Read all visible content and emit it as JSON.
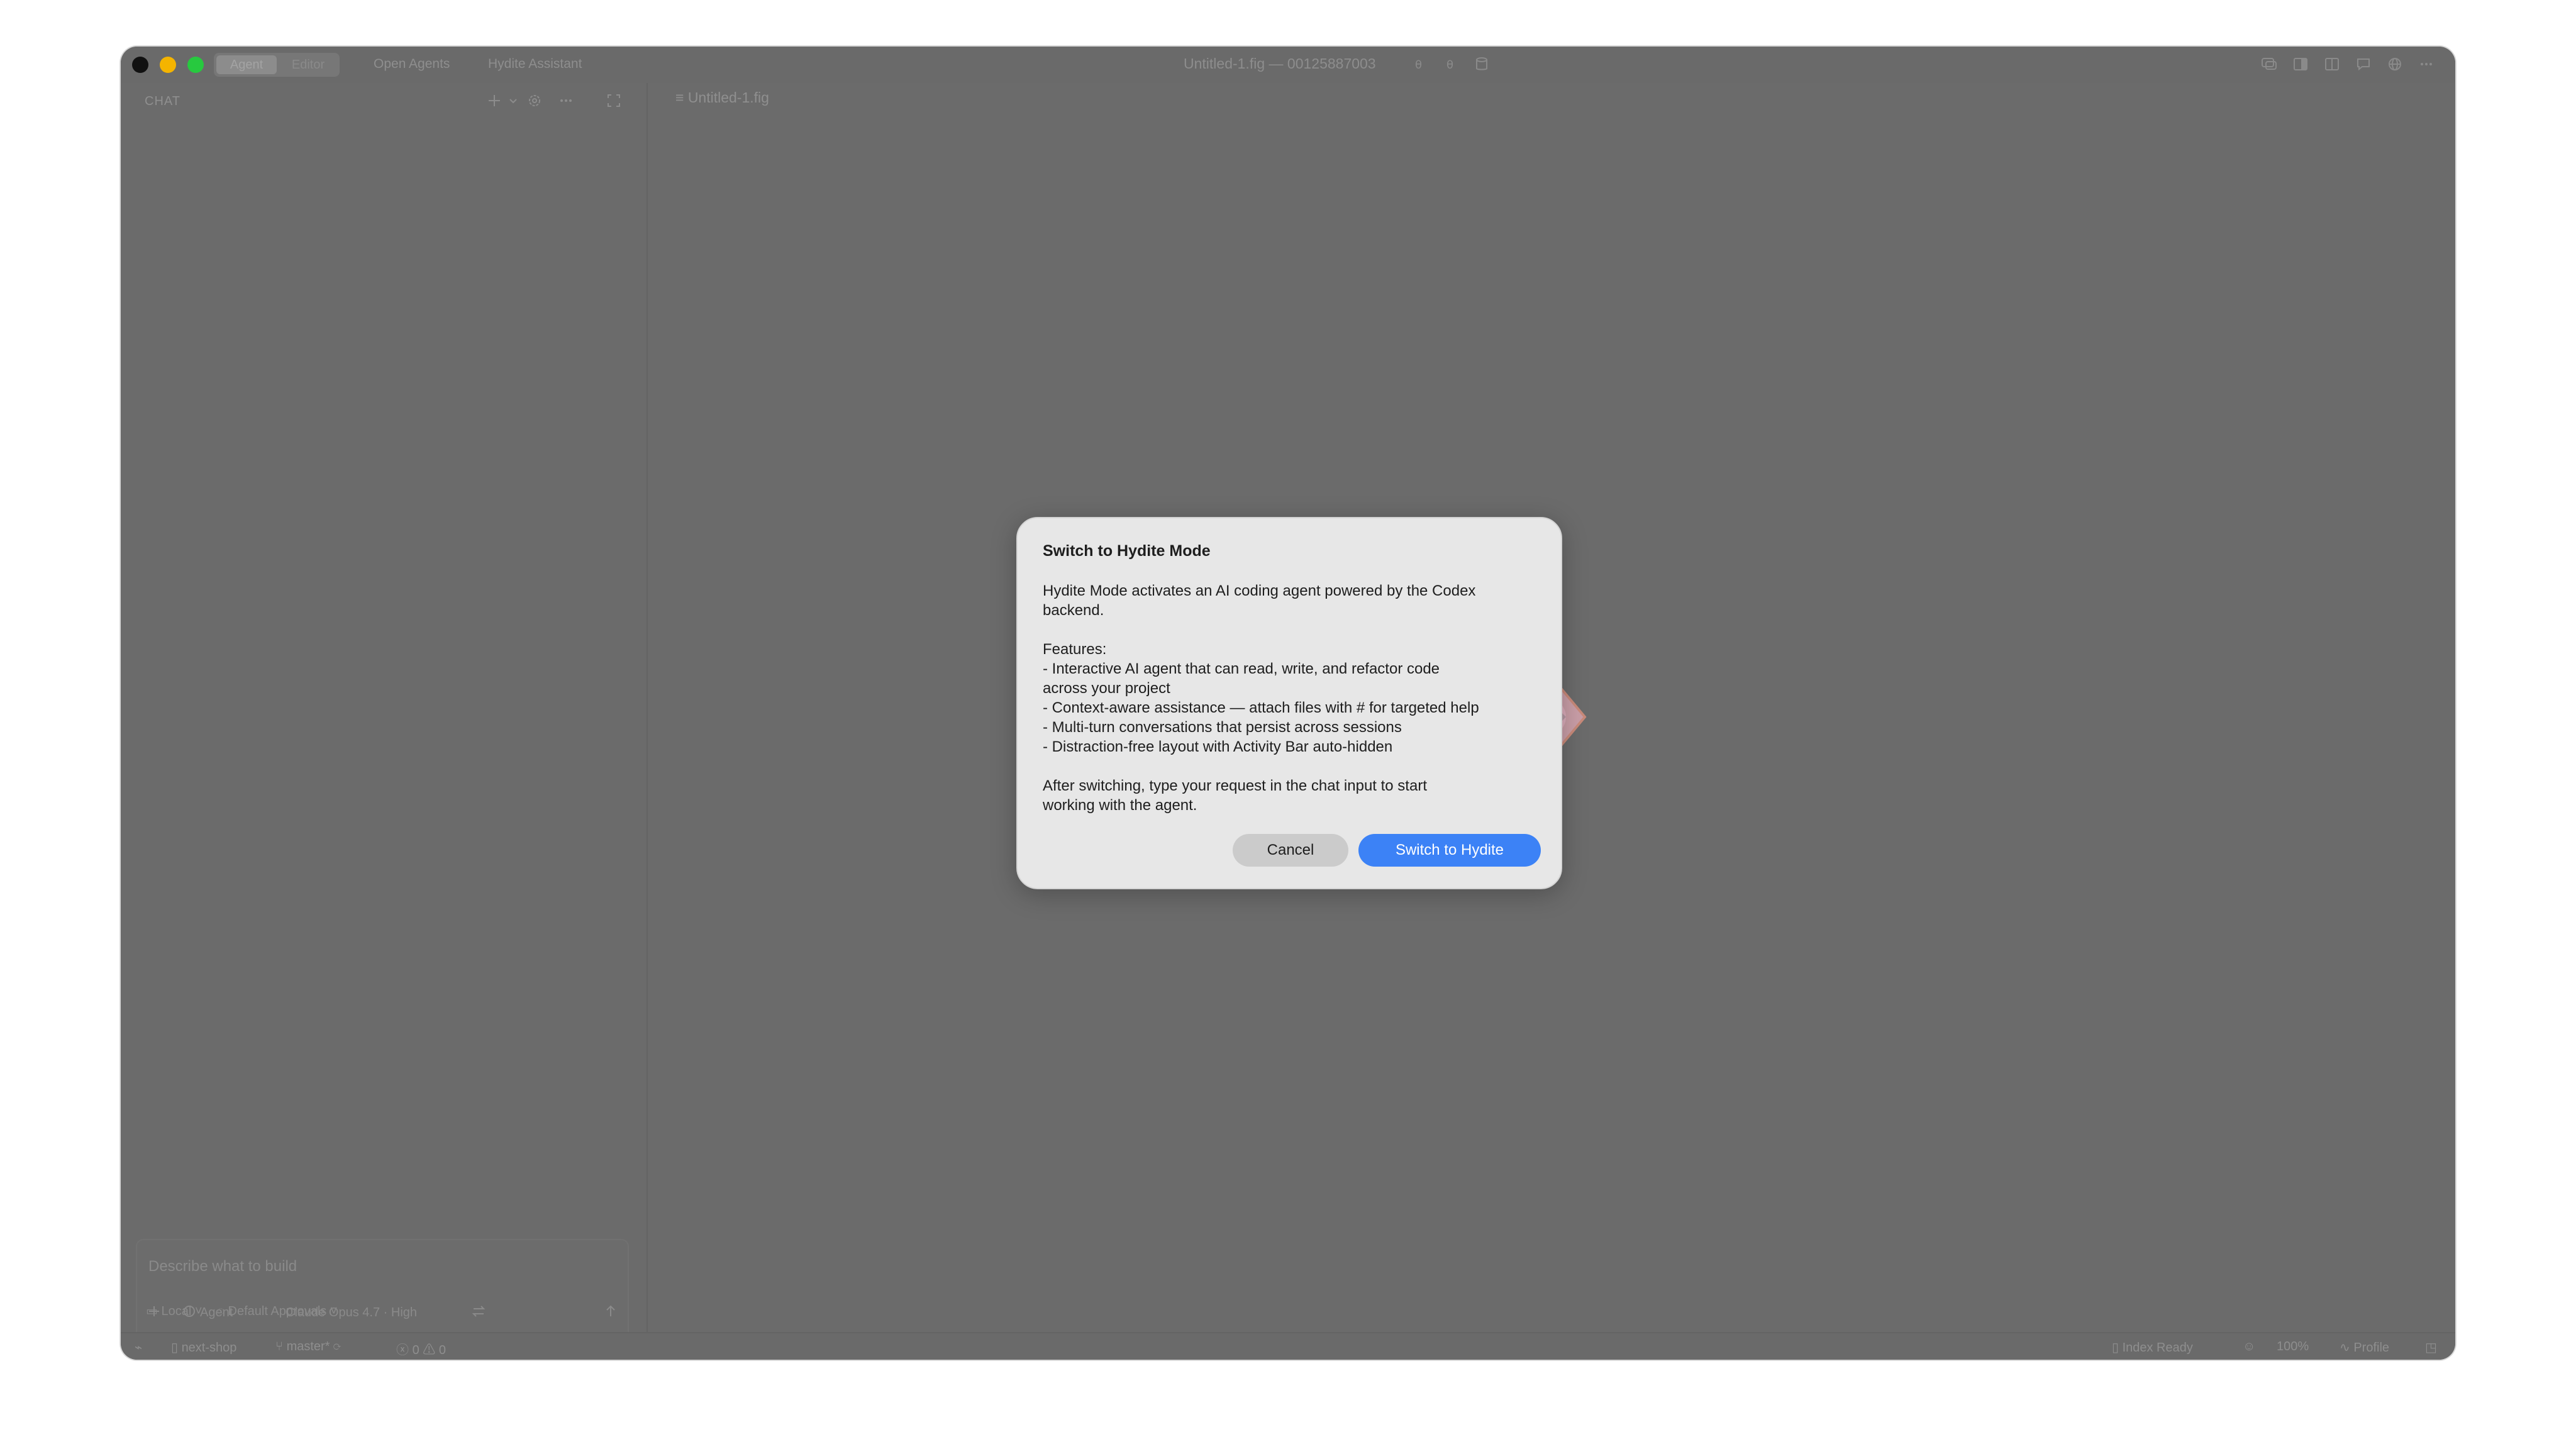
{
  "titlebar": {
    "mode_tabs": [
      "Agent",
      "Editor"
    ],
    "links": [
      "Open Agents",
      "Hydite Assistant"
    ],
    "title": "Untitled-1.fig — 00125887003"
  },
  "sidebar": {
    "header": "CHAT",
    "composer": {
      "placeholder": "Describe what to build",
      "mode": "Agent",
      "model": "Claude Opus 4.7 · High"
    },
    "environment": "Local",
    "approvals": "Default Approvals"
  },
  "editor": {
    "tab": "Untitled-1.fig"
  },
  "statusbar": {
    "project": "next-shop",
    "branch": "master*",
    "errors": "0",
    "warnings": "0",
    "index": "Index Ready",
    "zoom": "100%",
    "profile": "Profile"
  },
  "dialog": {
    "title": "Switch to Hydite Mode",
    "intro": [
      "Hydite Mode activates an AI coding agent powered by the Codex",
      "backend."
    ],
    "features_heading": "Features:",
    "features": [
      "- Interactive AI agent that can read, write, and refactor code",
      "across your project",
      "- Context-aware assistance — attach files with # for targeted help",
      "- Multi-turn conversations that persist across sessions",
      "- Distraction-free layout with Activity Bar auto-hidden"
    ],
    "outro": [
      "After switching, type your request in the chat input to start",
      "working with the agent."
    ],
    "cancel_label": "Cancel",
    "confirm_label": "Switch to Hydite"
  },
  "colors": {
    "accent": "#3c82f6",
    "overlay": "#6b6b6b"
  }
}
